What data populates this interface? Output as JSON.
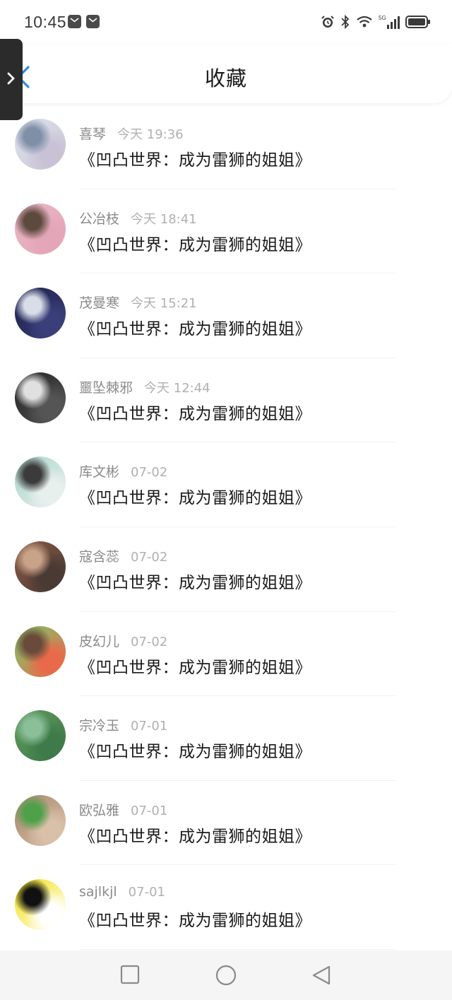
{
  "status": {
    "time": "10:45",
    "network": "5G"
  },
  "header": {
    "title": "收藏"
  },
  "items": [
    {
      "user": "喜琴",
      "time": "今天 19:36",
      "book": "《凹凸世界：成为雷狮的姐姐》",
      "colors": [
        "#dfe6ee",
        "#7f8fa8",
        "#c9c2d6"
      ]
    },
    {
      "user": "公冶枝",
      "time": "今天 18:41",
      "book": "《凹凸世界：成为雷狮的姐姐》",
      "colors": [
        "#e9b7c6",
        "#5d4a3e",
        "#e4a5b8"
      ]
    },
    {
      "user": "茂曼寒",
      "time": "今天 15:21",
      "book": "《凹凸世界：成为雷狮的姐姐》",
      "colors": [
        "#1c1f4a",
        "#d8dde8",
        "#3a3f7a"
      ]
    },
    {
      "user": "噩坠棘邪",
      "time": "今天 12:44",
      "book": "《凹凸世界：成为雷狮的姐姐》",
      "colors": [
        "#222222",
        "#e0e0e0",
        "#555555"
      ]
    },
    {
      "user": "库文彬",
      "time": "07-02",
      "book": "《凹凸世界：成为雷狮的姐姐》",
      "colors": [
        "#a9d3c9",
        "#3b3b3b",
        "#e8f0ee"
      ]
    },
    {
      "user": "寇含蕊",
      "time": "07-02",
      "book": "《凹凸世界：成为雷狮的姐姐》",
      "colors": [
        "#8a5a44",
        "#c9a28a",
        "#4a3a34"
      ]
    },
    {
      "user": "皮幻儿",
      "time": "07-02",
      "book": "《凹凸世界：成为雷狮的姐姐》",
      "colors": [
        "#7bc96a",
        "#6a4a3a",
        "#e86a4a"
      ]
    },
    {
      "user": "宗冷玉",
      "time": "07-01",
      "book": "《凹凸世界：成为雷狮的姐姐》",
      "colors": [
        "#5f9a5a",
        "#8abf9a",
        "#3e7a4a"
      ]
    },
    {
      "user": "欧弘雅",
      "time": "07-01",
      "book": "《凹凸世界：成为雷狮的姐姐》",
      "colors": [
        "#a7866a",
        "#4fa04a",
        "#d9c0a8"
      ]
    },
    {
      "user": "sajlkjl",
      "time": "07-01",
      "book": "《凹凸世界：成为雷狮的姐姐》",
      "colors": [
        "#f2e20f",
        "#111111",
        "#ffffff"
      ]
    }
  ],
  "accent": "#2b8ce6"
}
